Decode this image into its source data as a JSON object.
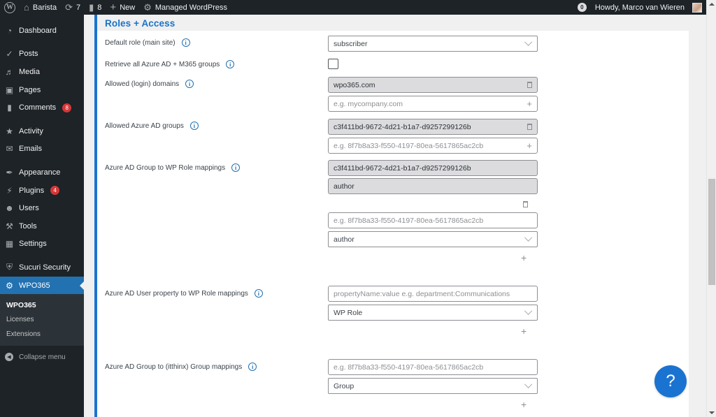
{
  "adminbar": {
    "site_name": "Barista",
    "updates_count": "7",
    "comments_count": "8",
    "new_label": "New",
    "managed_label": "Managed WordPress",
    "notifications_count": "0",
    "greeting": "Howdy, Marco van Wieren"
  },
  "sidebar": {
    "items": [
      {
        "label": "Dashboard",
        "icon": "dashboard-icon"
      },
      {
        "label": "Posts",
        "icon": "pin-icon"
      },
      {
        "label": "Media",
        "icon": "media-icon"
      },
      {
        "label": "Pages",
        "icon": "pages-icon"
      },
      {
        "label": "Comments",
        "icon": "comment-icon",
        "badge": "8"
      },
      {
        "label": "Activity",
        "icon": "activity-icon"
      },
      {
        "label": "Emails",
        "icon": "envelope-icon"
      },
      {
        "label": "Appearance",
        "icon": "brush-icon"
      },
      {
        "label": "Plugins",
        "icon": "plugin-icon",
        "badge": "4"
      },
      {
        "label": "Users",
        "icon": "user-icon"
      },
      {
        "label": "Tools",
        "icon": "wrench-icon"
      },
      {
        "label": "Settings",
        "icon": "settings-icon"
      },
      {
        "label": "Sucuri Security",
        "icon": "shield-icon"
      },
      {
        "label": "WPO365",
        "icon": "gear-icon",
        "active": true
      }
    ],
    "submenu": [
      {
        "label": "WPO365",
        "current": true
      },
      {
        "label": "Licenses"
      },
      {
        "label": "Extensions"
      }
    ],
    "collapse_label": "Collapse menu"
  },
  "main": {
    "section_title": "Roles + Access",
    "default_role": {
      "label": "Default role (main site)",
      "value": "subscriber"
    },
    "retrieve_groups": {
      "label": "Retrieve all Azure AD + M365 groups",
      "checked": false
    },
    "allowed_domains": {
      "label": "Allowed (login) domains",
      "values": [
        "wpo365.com"
      ],
      "placeholder": "e.g. mycompany.com"
    },
    "allowed_groups": {
      "label": "Allowed Azure AD groups",
      "values": [
        "c3f411bd-9672-4d21-b1a7-d9257299126b"
      ],
      "placeholder": "e.g. 8f7b8a33-f550-4197-80ea-5617865ac2cb"
    },
    "group_role_mappings": {
      "label": "Azure AD Group to WP Role mappings",
      "mappings": [
        {
          "group": "c3f411bd-9672-4d21-b1a7-d9257299126b",
          "role": "author"
        }
      ],
      "new_group_placeholder": "e.g. 8f7b8a33-f550-4197-80ea-5617865ac2cb",
      "new_role_value": "author"
    },
    "user_property_mappings": {
      "label": "Azure AD User property to WP Role mappings",
      "property_placeholder": "propertyName:value e.g. department:Communications",
      "role_value": "WP Role"
    },
    "itthinx_mappings": {
      "label": "Azure AD Group to (itthinx) Group mappings",
      "group_placeholder": "e.g. 8f7b8a33-f550-4197-80ea-5617865ac2cb",
      "group_value": "Group"
    }
  },
  "help": {
    "label": "?"
  }
}
